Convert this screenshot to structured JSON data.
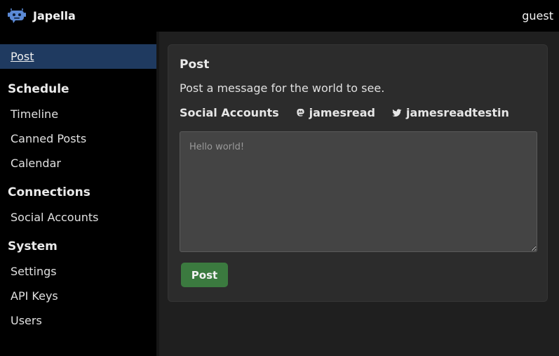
{
  "app": {
    "name": "Japella",
    "user": "guest"
  },
  "sidebar": {
    "active": "Post",
    "sections": [
      {
        "heading": "Schedule",
        "items": [
          "Timeline",
          "Canned Posts",
          "Calendar"
        ]
      },
      {
        "heading": "Connections",
        "items": [
          "Social Accounts"
        ]
      },
      {
        "heading": "System",
        "items": [
          "Settings",
          "API Keys",
          "Users"
        ]
      }
    ]
  },
  "post_card": {
    "title": "Post",
    "description": "Post a message for the world to see.",
    "accounts_label": "Social Accounts",
    "accounts": [
      {
        "name": "jamesread",
        "icon": "mastodon-icon"
      },
      {
        "name": "jamesreadtestin",
        "icon": "twitter-icon"
      }
    ],
    "placeholder": "Hello world!",
    "button_label": "Post"
  },
  "colors": {
    "active_nav": "#1f3a60",
    "post_button": "#3b7a3f",
    "logo": "#5b8ad6"
  }
}
